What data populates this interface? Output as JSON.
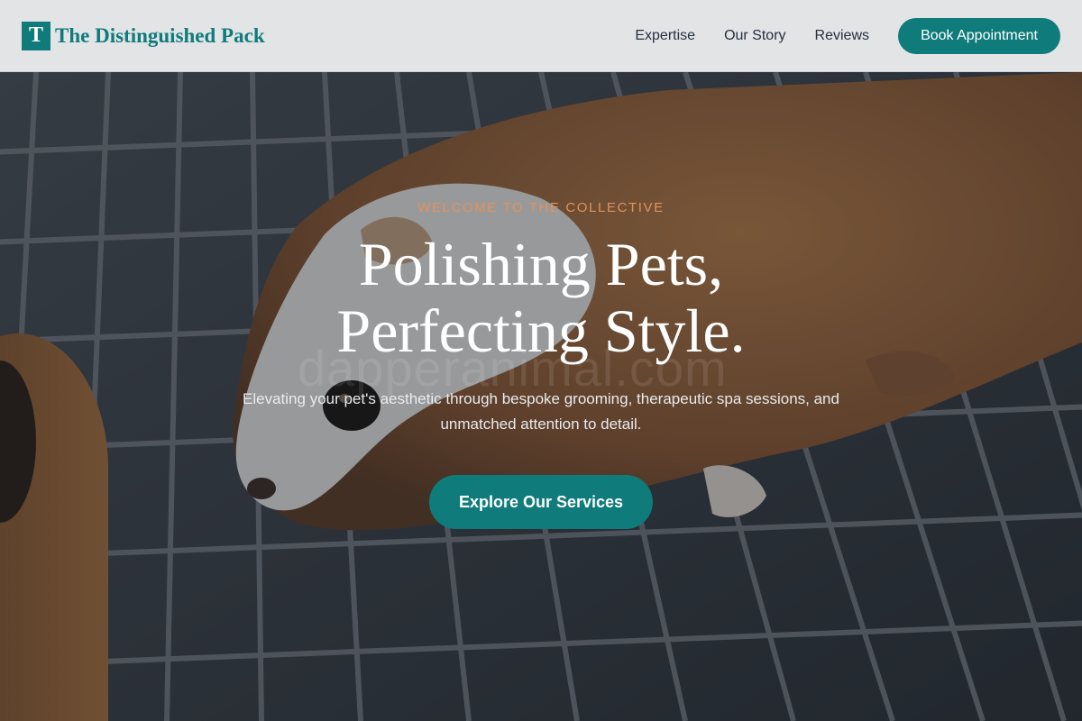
{
  "brand": {
    "mark": "T",
    "name": "The Distinguished Pack"
  },
  "nav": {
    "links": [
      "Expertise",
      "Our Story",
      "Reviews"
    ],
    "cta": "Book Appointment"
  },
  "hero": {
    "eyebrow": "WELCOME TO THE COLLECTIVE",
    "headline_line1": "Polishing Pets,",
    "headline_line2": "Perfecting Style.",
    "subtext": "Elevating your pet's aesthetic through bespoke grooming, therapeutic spa sessions, and unmatched attention to detail.",
    "cta": "Explore Our Services",
    "watermark": "dapperanimal.com",
    "image_subject": "guinea pig standing on a metal grill"
  },
  "colors": {
    "accent": "#0f7b7b",
    "eyebrow": "#e0925a",
    "header_bg": "#e3e4e6",
    "nav_text": "#243040"
  }
}
